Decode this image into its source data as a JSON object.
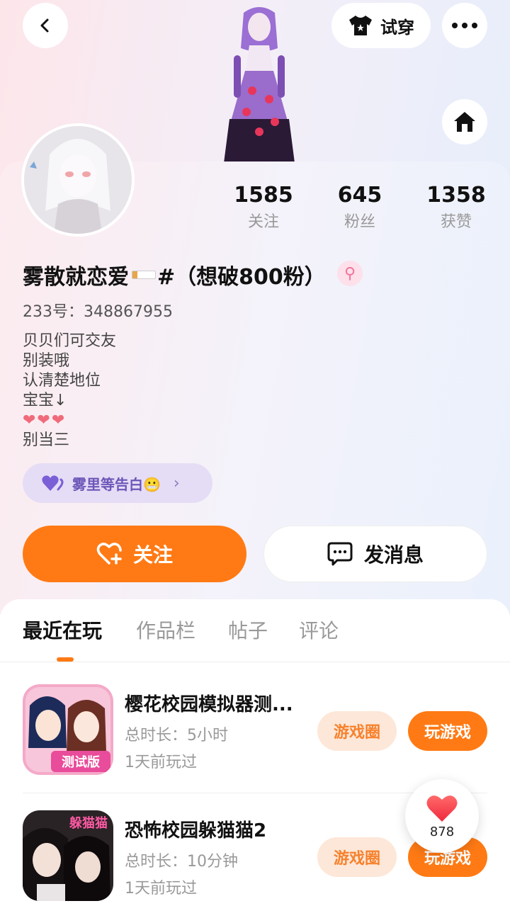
{
  "header": {
    "tryon_label": "试穿",
    "icons": [
      "back-icon",
      "shirt-icon",
      "more-icon",
      "home-icon"
    ]
  },
  "profile": {
    "stats": [
      {
        "value": "1585",
        "label": "关注"
      },
      {
        "value": "645",
        "label": "粉丝"
      },
      {
        "value": "1358",
        "label": "获赞"
      }
    ],
    "nickname_part1": "雾散就恋爱",
    "nickname_part2": "#（想破800粉）",
    "gender_symbol": "⚲",
    "uid": "233号：348867955",
    "bio": [
      "贝贝们可交友",
      "别装哦",
      "认清楚地位",
      "宝宝↓",
      "❤❤❤",
      "别当三"
    ],
    "confess_label": "雾里等告白😬",
    "follow_label": "关注",
    "message_label": "发消息"
  },
  "tabs": [
    "最近在玩",
    "作品栏",
    "帖子",
    "评论"
  ],
  "games": [
    {
      "title": "樱花校园模拟器测...",
      "duration": "总时长：5小时",
      "last_played": "1天前玩过",
      "circle_label": "游戏圈",
      "play_label": "玩游戏",
      "icon_badge": "测试版"
    },
    {
      "title": "恐怖校园躲猫猫2",
      "duration": "总时长：10分钟",
      "last_played": "1天前玩过",
      "circle_label": "游戏圈",
      "play_label": "玩游戏",
      "icon_badge": "躲猫猫"
    }
  ],
  "like_float": {
    "count": "878"
  },
  "colors": {
    "accent": "#ff7a14",
    "confess_text": "#6c56b8",
    "gender": "#f2749a"
  }
}
